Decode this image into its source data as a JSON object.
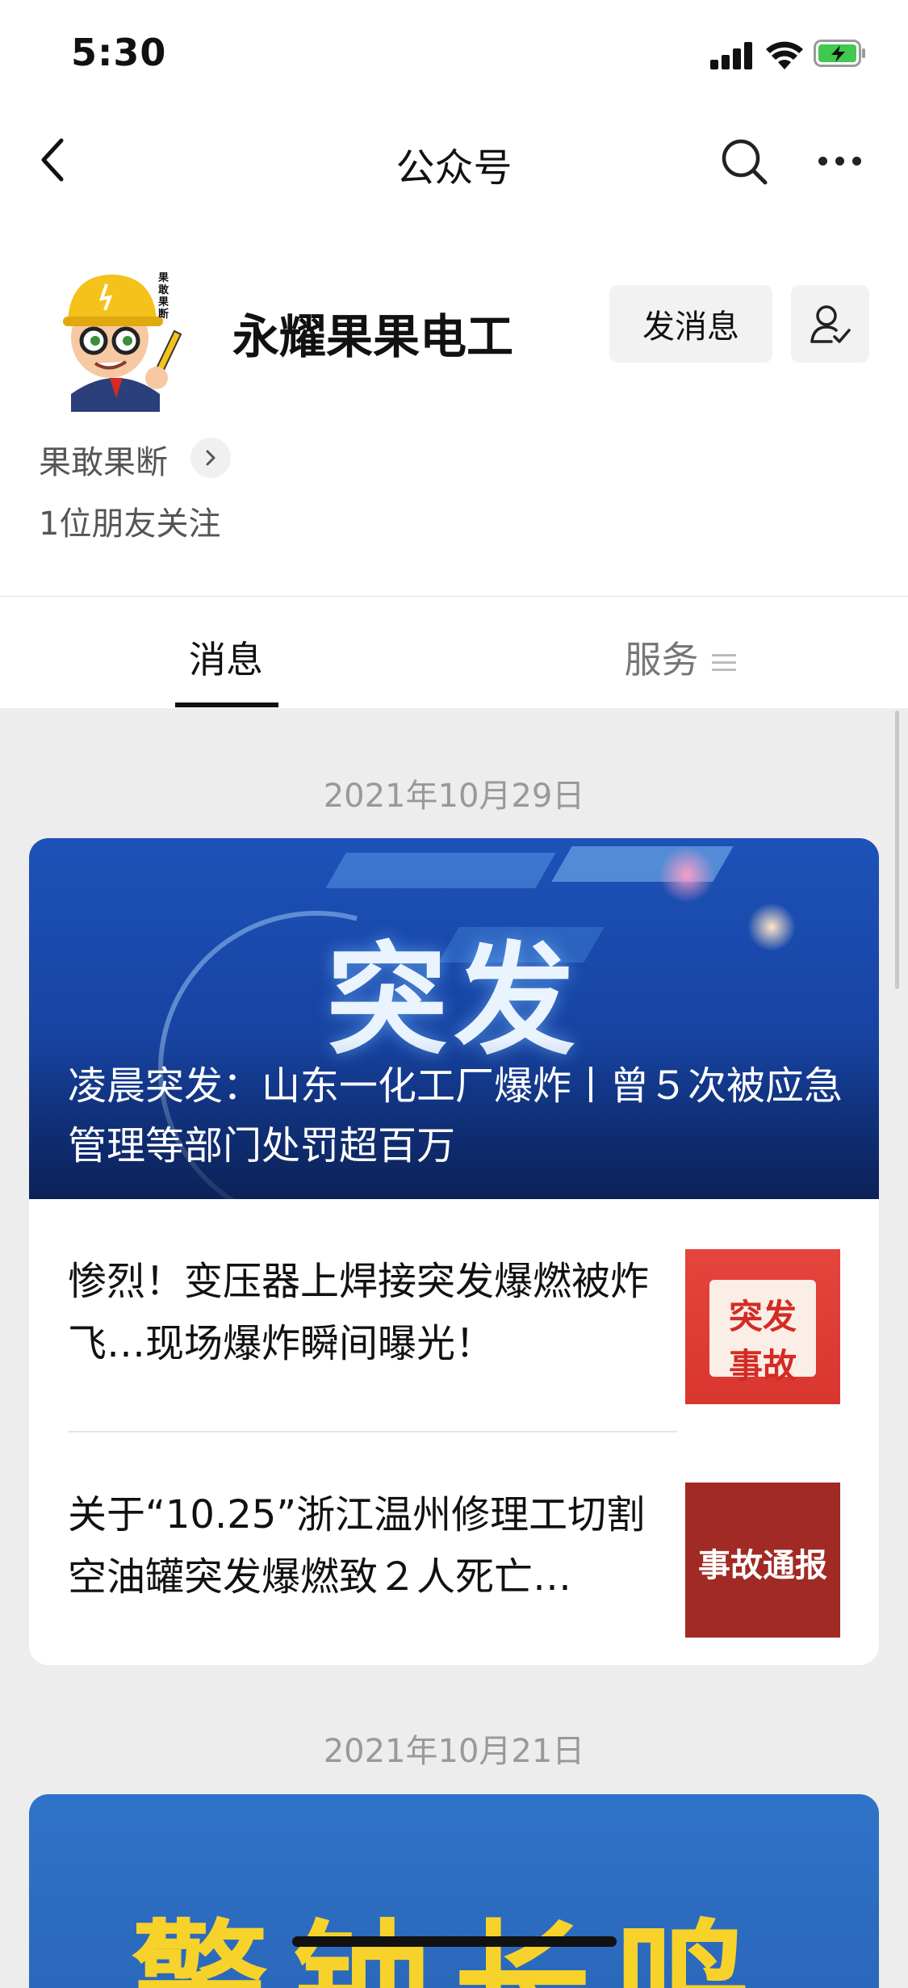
{
  "status_bar": {
    "time": "5:30"
  },
  "nav": {
    "title": "公众号"
  },
  "account": {
    "name": "永耀果果电工",
    "message_button": "发消息",
    "avatar_text": "果敢果断",
    "slogan": "果敢果断",
    "followers": "1位朋友关注"
  },
  "tabs": {
    "messages": "消息",
    "services": "服务"
  },
  "feed": [
    {
      "date": "2021年10月29日",
      "banner_text": "突发",
      "headline": "凌晨突发：山东一化工厂爆炸丨曾５次被应急管理等部门处罚超百万",
      "articles": [
        {
          "title": "惨烈！变压器上焊接突发爆燃被炸飞…现场爆炸瞬间曝光！",
          "thumb_text": "突发事故"
        },
        {
          "title": "关于“10.25”浙江温州修理工切割空油罐突发爆燃致２人死亡…",
          "thumb_text": "事故通报"
        }
      ]
    },
    {
      "date": "2021年10月21日",
      "banner_text": "警钟长鸣"
    }
  ],
  "colors": {
    "background": "#ededed",
    "card": "#ffffff",
    "banner_blue": "#1947a9",
    "thumb_red": "#d8362f",
    "thumb_dark_red": "#a12a25",
    "banner2_yellow": "#f7d22a"
  }
}
